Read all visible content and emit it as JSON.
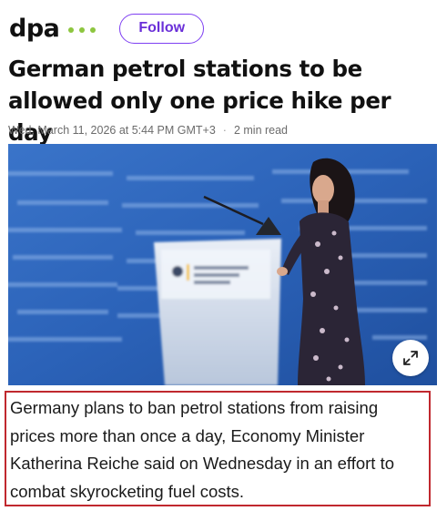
{
  "header": {
    "brand": "dpa",
    "follow_label": "Follow",
    "dot_color": "#8dc63f",
    "accent_color": "#7e3ff2"
  },
  "article": {
    "title": "German petrol stations to be allowed only one price hike per day",
    "date": "Wed, March 11, 2026 at 5:44 PM GMT+3",
    "separator": "·",
    "read_time": "2 min read",
    "image": {
      "expand_icon": "expand-arrows-icon"
    },
    "lede": "Germany plans to ban petrol stations from raising prices more than once a day, Economy Minister Katherina Reiche said on Wednesday in an effort to combat skyrocketing fuel costs.",
    "highlight_color": "#c0282e"
  }
}
